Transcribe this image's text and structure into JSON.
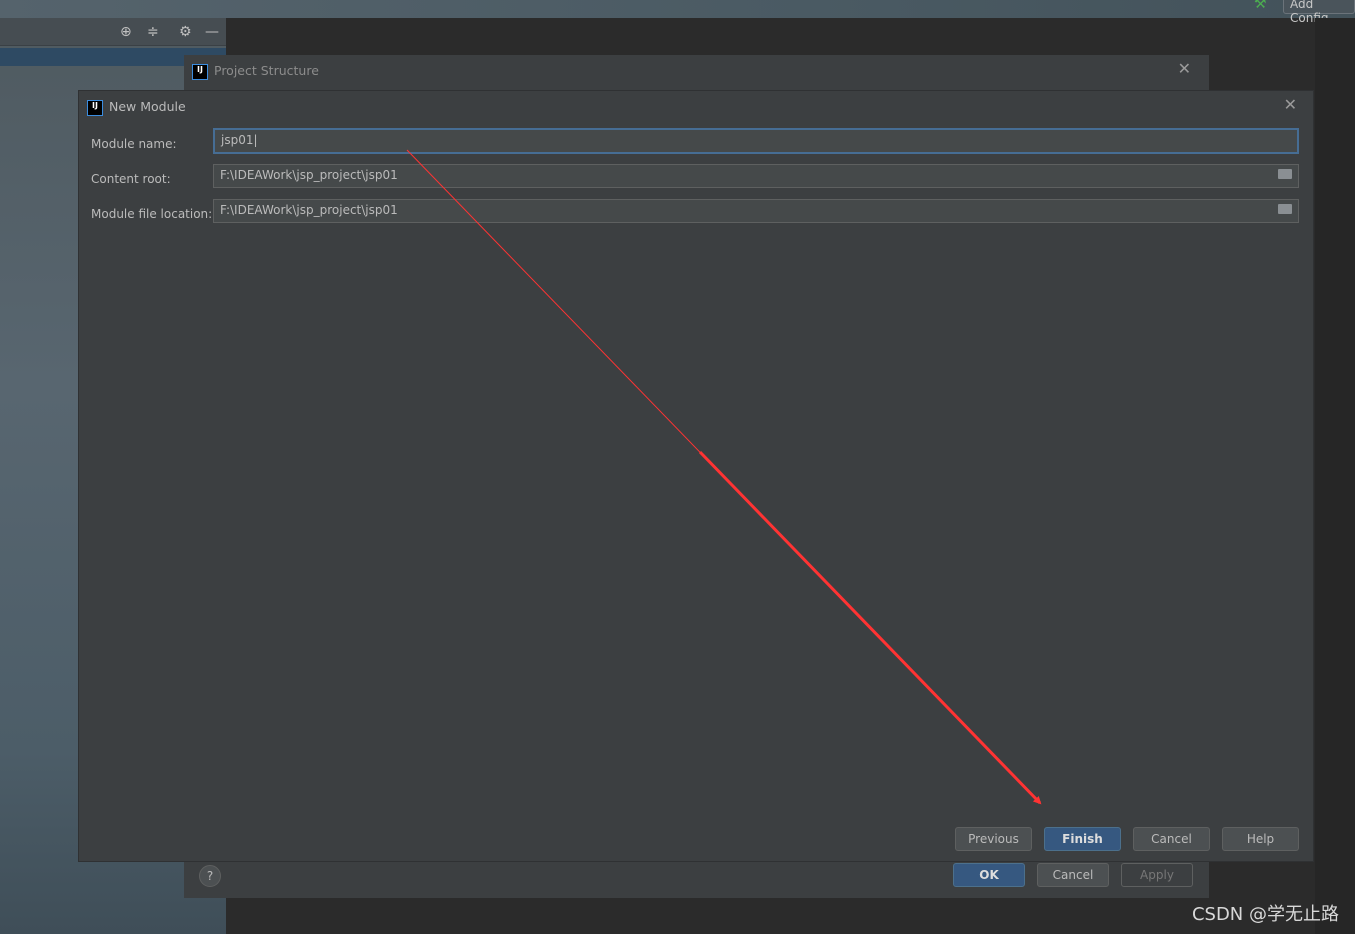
{
  "ide": {
    "add_config_label": "Add Config"
  },
  "project_structure": {
    "title": "Project Structure",
    "ok": "OK",
    "cancel": "Cancel",
    "apply": "Apply",
    "help": "?"
  },
  "new_module": {
    "title": "New Module",
    "fields": [
      {
        "label": "Module name:",
        "value": "jsp01"
      },
      {
        "label": "Content root:",
        "value": "F:\\IDEAWork\\jsp_project\\jsp01"
      },
      {
        "label": "Module file location:",
        "value": "F:\\IDEAWork\\jsp_project\\jsp01"
      }
    ],
    "buttons": {
      "previous": "Previous",
      "finish": "Finish",
      "cancel": "Cancel",
      "help": "Help"
    }
  },
  "annotation": {
    "arrow_color": "#ff3333"
  },
  "watermark": "CSDN @学无止路"
}
